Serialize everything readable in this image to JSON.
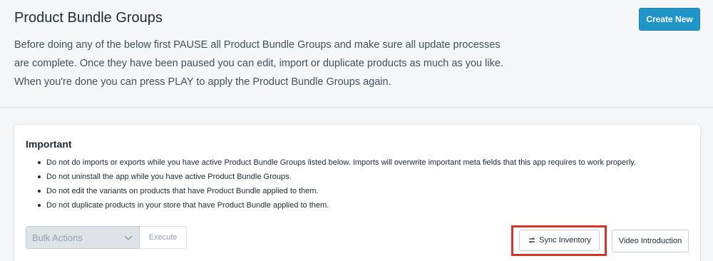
{
  "header": {
    "title": "Product Bundle Groups",
    "create_label": "Create New",
    "intro": "Before doing any of the below first PAUSE all Product Bundle Groups and make sure all update processes are complete. Once they have been paused you can edit, import or duplicate products as much as you like. When you're done you can press PLAY to apply the Product Bundle Groups again."
  },
  "important": {
    "title": "Important",
    "rules": [
      "Do not do imports or exports while you have active Product Bundle Groups listed below. Imports will overwrite important meta fields that this app requires to work properly.",
      "Do not uninstall the app while you have active Product Bundle Groups.",
      "Do not edit the variants on products that have Product Bundle applied to them.",
      "Do not duplicate products in your store that have Product Bundle applied to them."
    ]
  },
  "actions": {
    "bulk_placeholder": "Bulk Actions",
    "execute_label": "Execute",
    "sync_label": "Sync Inventory",
    "sync_icon": "refresh-icon",
    "video_label": "Video Introduction"
  },
  "colors": {
    "primary": "#2095c8",
    "highlight": "#d9342b",
    "background": "#f4f6f8"
  }
}
